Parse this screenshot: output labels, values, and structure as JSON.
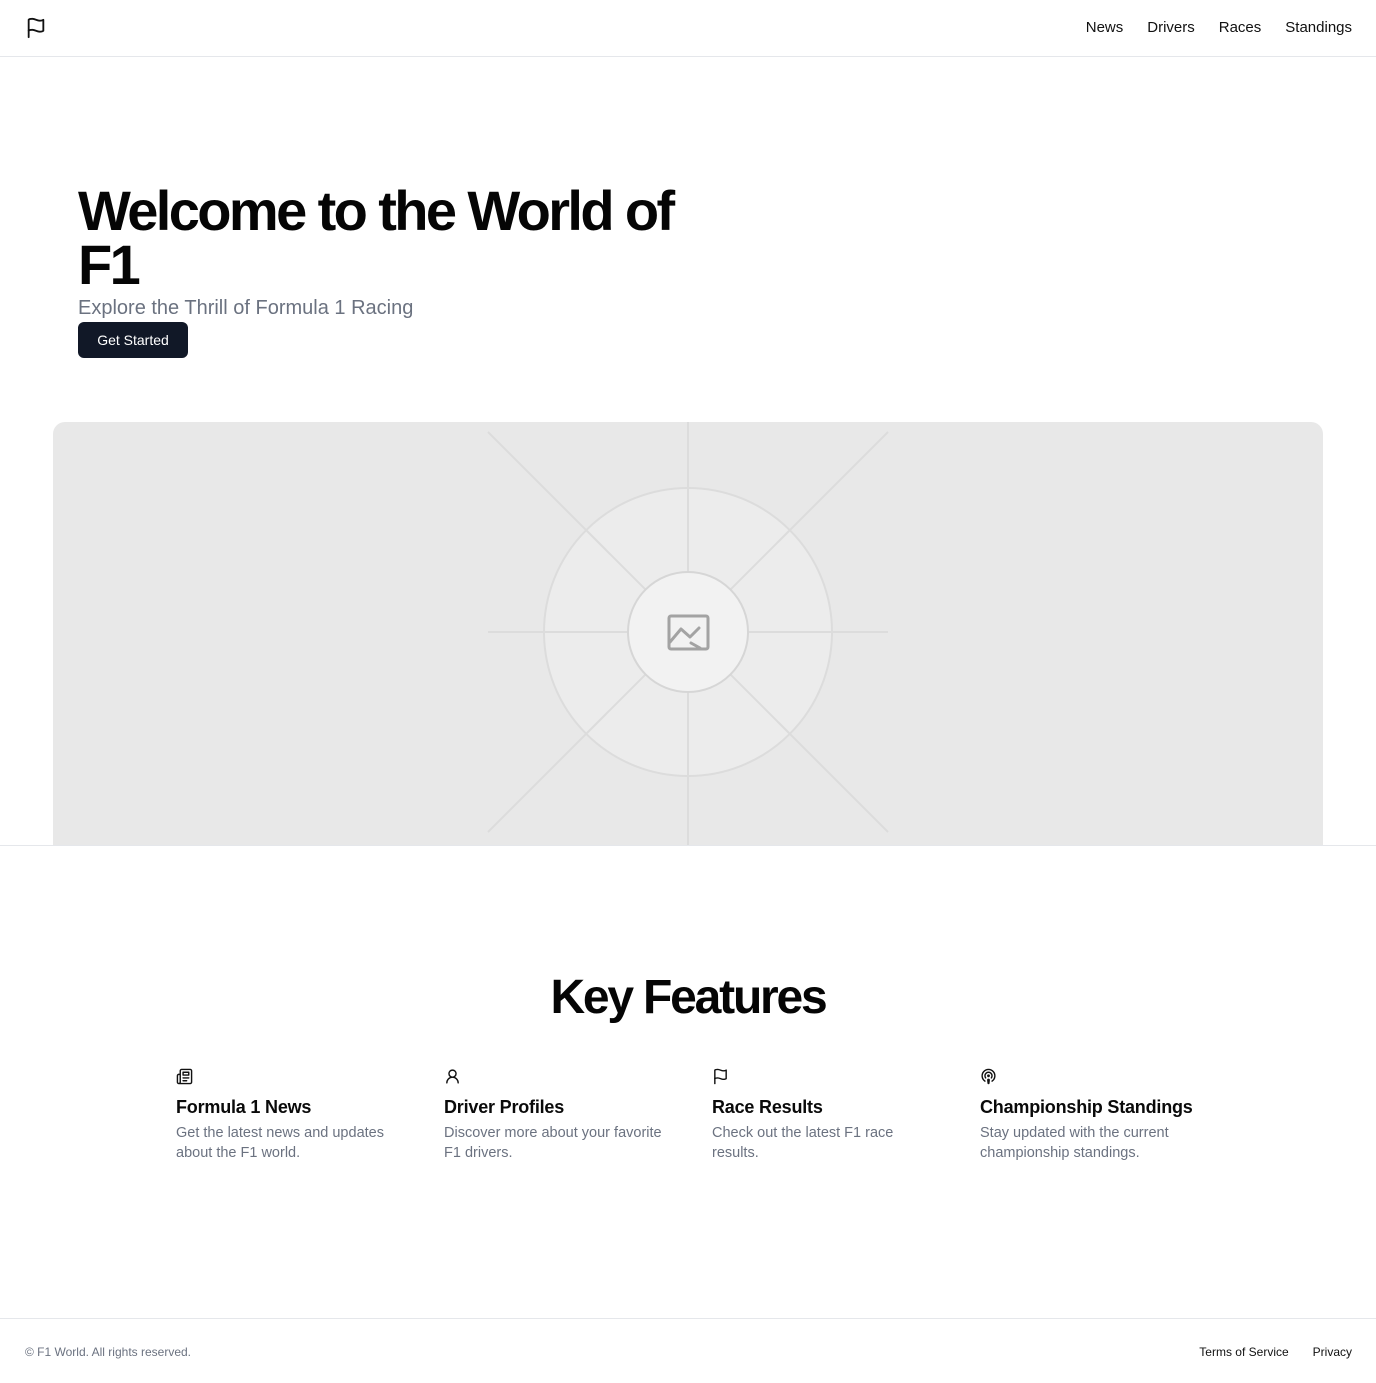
{
  "header": {
    "logo_icon": "flag-icon",
    "nav": [
      {
        "label": "News"
      },
      {
        "label": "Drivers"
      },
      {
        "label": "Races"
      },
      {
        "label": "Standings"
      }
    ]
  },
  "hero": {
    "title": "Welcome to the World of F1",
    "subtitle": "Explore the Thrill of Formula 1 Racing",
    "cta_label": "Get Started",
    "image_icon": "image-placeholder-icon"
  },
  "features": {
    "title": "Key Features",
    "items": [
      {
        "icon": "newspaper-icon",
        "title": "Formula 1 News",
        "description": "Get the latest news and updates about the F1 world."
      },
      {
        "icon": "user-icon",
        "title": "Driver Profiles",
        "description": "Discover more about your favorite F1 drivers."
      },
      {
        "icon": "flag-icon",
        "title": "Race Results",
        "description": "Check out the latest F1 race results."
      },
      {
        "icon": "podcast-icon",
        "title": "Championship Standings",
        "description": "Stay updated with the current championship standings."
      }
    ]
  },
  "footer": {
    "copyright": "© F1 World. All rights reserved.",
    "links": [
      {
        "label": "Terms of Service"
      },
      {
        "label": "Privacy"
      }
    ]
  },
  "colors": {
    "primary_button": "#111827",
    "muted_text": "#6b7280",
    "border": "#e5e7eb",
    "placeholder_bg": "#e8e8e8"
  }
}
